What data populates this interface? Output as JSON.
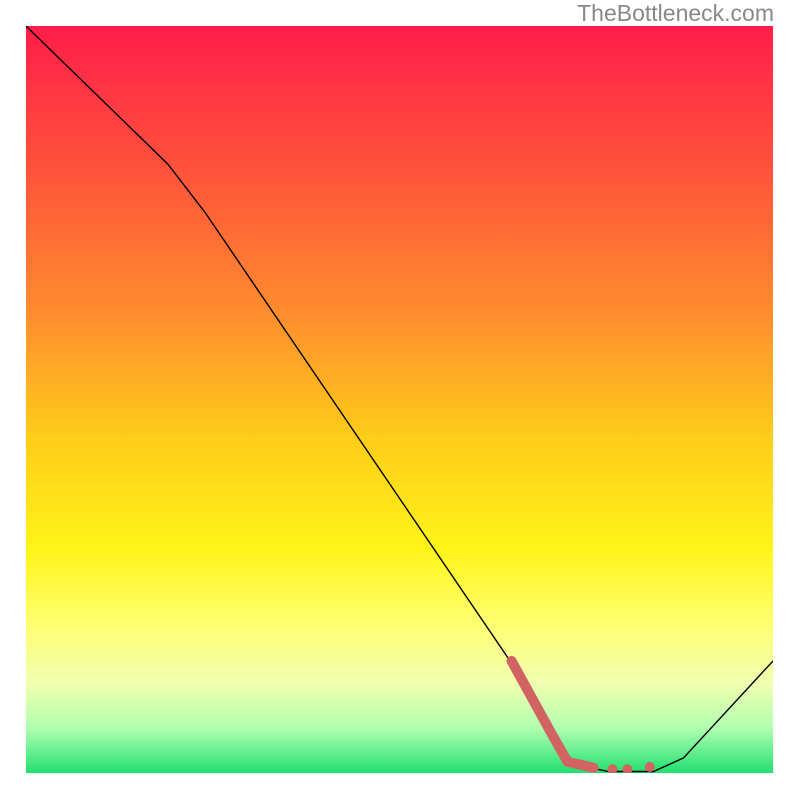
{
  "watermark": "TheBottleneck.com",
  "chart_data": {
    "type": "line",
    "title": "",
    "xlabel": "",
    "ylabel": "",
    "xlim": [
      0,
      100
    ],
    "ylim": [
      0,
      100
    ],
    "gradient_stops": [
      {
        "offset": 0,
        "color": "#ff1d4a"
      },
      {
        "offset": 20,
        "color": "#ff553a"
      },
      {
        "offset": 38,
        "color": "#ff8b2e"
      },
      {
        "offset": 55,
        "color": "#ffcc1a"
      },
      {
        "offset": 70,
        "color": "#fff41a"
      },
      {
        "offset": 80,
        "color": "#ffff70"
      },
      {
        "offset": 88,
        "color": "#f0ffb0"
      },
      {
        "offset": 94,
        "color": "#b0ffb0"
      },
      {
        "offset": 100,
        "color": "#20e070"
      }
    ],
    "series": [
      {
        "name": "bottleneck-curve",
        "stroke": "#000000",
        "stroke_width": 1.4,
        "points": [
          {
            "x": 0,
            "y": 100
          },
          {
            "x": 19,
            "y": 81.5
          },
          {
            "x": 24,
            "y": 75
          },
          {
            "x": 66.5,
            "y": 12.5
          },
          {
            "x": 70,
            "y": 5
          },
          {
            "x": 73,
            "y": 1.2
          },
          {
            "x": 78,
            "y": 0.2
          },
          {
            "x": 84,
            "y": 0.2
          },
          {
            "x": 88,
            "y": 2
          },
          {
            "x": 100,
            "y": 15
          }
        ]
      }
    ],
    "highlight": {
      "name": "optimal-range",
      "stroke": "#d16363",
      "stroke_width": 10,
      "points": [
        {
          "x": 65,
          "y": 15
        },
        {
          "x": 70.5,
          "y": 5
        },
        {
          "x": 72.5,
          "y": 1.5
        },
        {
          "x": 76,
          "y": 0.7
        }
      ],
      "dots": [
        {
          "x": 78.5,
          "y": 0.5
        },
        {
          "x": 80.5,
          "y": 0.5
        },
        {
          "x": 83.5,
          "y": 0.8
        }
      ],
      "dot_r": 5
    }
  }
}
